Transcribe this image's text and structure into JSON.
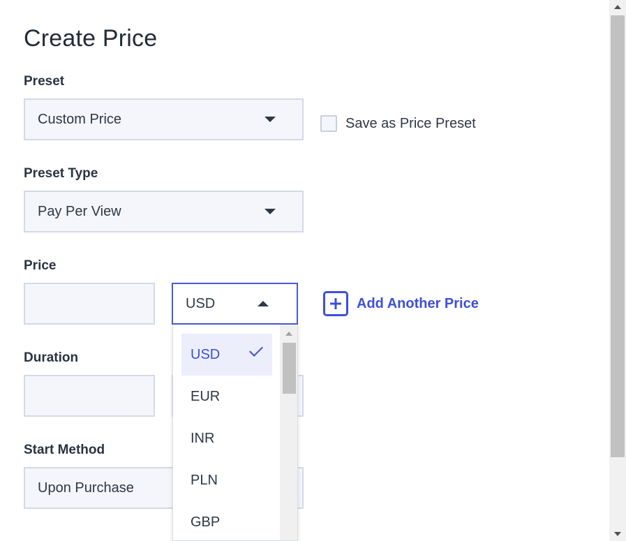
{
  "page": {
    "title": "Create Price"
  },
  "preset": {
    "label": "Preset",
    "value": "Custom Price",
    "save_checkbox_label": "Save as Price Preset",
    "save_checked": false
  },
  "preset_type": {
    "label": "Preset Type",
    "value": "Pay Per View"
  },
  "price": {
    "label": "Price",
    "amount": "",
    "currency": "USD",
    "add_another_label": "Add Another Price"
  },
  "currency_dropdown": {
    "options": [
      "USD",
      "EUR",
      "INR",
      "PLN",
      "GBP"
    ],
    "selected": "USD"
  },
  "duration": {
    "label": "Duration",
    "amount": ""
  },
  "start_method": {
    "label": "Start Method",
    "value": "Upon Purchase"
  },
  "colors": {
    "accent": "#3d4fd8",
    "field_bg": "#f4f6fb",
    "border": "#d4d9e6",
    "selected_bg": "#eceefc"
  }
}
